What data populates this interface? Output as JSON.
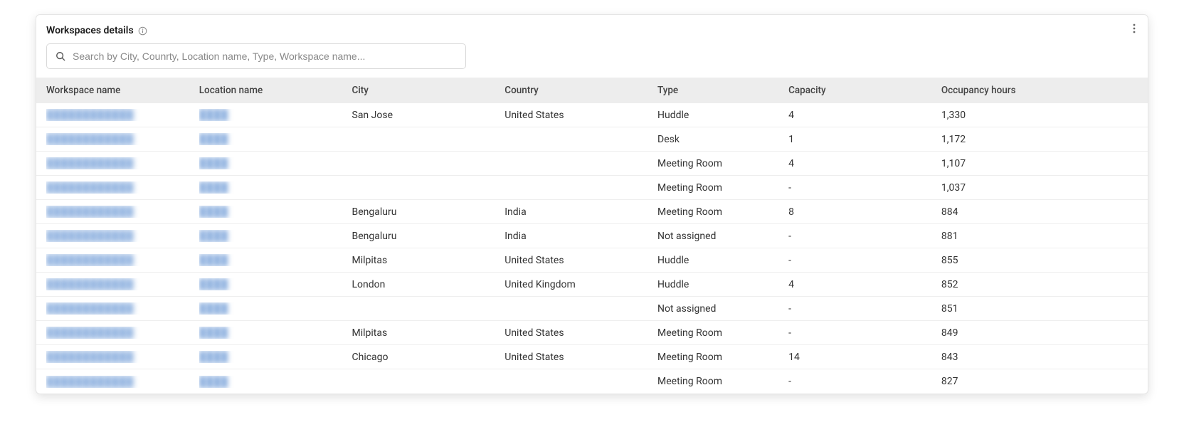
{
  "card": {
    "title": "Workspaces details"
  },
  "search": {
    "placeholder": "Search by City, Counrty, Location name, Type, Workspace name..."
  },
  "table": {
    "columns": {
      "workspace": "Workspace name",
      "location": "Location name",
      "city": "City",
      "country": "Country",
      "type": "Type",
      "capacity": "Capacity",
      "occupancy": "Occupancy hours"
    },
    "rows": [
      {
        "city": "San Jose",
        "country": "United States",
        "type": "Huddle",
        "capacity": "4",
        "occupancy": "1,330"
      },
      {
        "city": "",
        "country": "",
        "type": "Desk",
        "capacity": "1",
        "occupancy": "1,172"
      },
      {
        "city": "",
        "country": "",
        "type": "Meeting Room",
        "capacity": "4",
        "occupancy": "1,107"
      },
      {
        "city": "",
        "country": "",
        "type": "Meeting Room",
        "capacity": "-",
        "occupancy": "1,037"
      },
      {
        "city": "Bengaluru",
        "country": "India",
        "type": "Meeting Room",
        "capacity": "8",
        "occupancy": "884"
      },
      {
        "city": "Bengaluru",
        "country": "India",
        "type": "Not assigned",
        "capacity": "-",
        "occupancy": "881"
      },
      {
        "city": "Milpitas",
        "country": "United States",
        "type": "Huddle",
        "capacity": "-",
        "occupancy": "855"
      },
      {
        "city": "London",
        "country": "United Kingdom",
        "type": "Huddle",
        "capacity": "4",
        "occupancy": "852"
      },
      {
        "city": "",
        "country": "",
        "type": "Not assigned",
        "capacity": "-",
        "occupancy": "851"
      },
      {
        "city": "Milpitas",
        "country": "United States",
        "type": "Meeting Room",
        "capacity": "-",
        "occupancy": "849"
      },
      {
        "city": "Chicago",
        "country": "United States",
        "type": "Meeting Room",
        "capacity": "14",
        "occupancy": "843"
      },
      {
        "city": "",
        "country": "",
        "type": "Meeting Room",
        "capacity": "-",
        "occupancy": "827"
      }
    ]
  }
}
